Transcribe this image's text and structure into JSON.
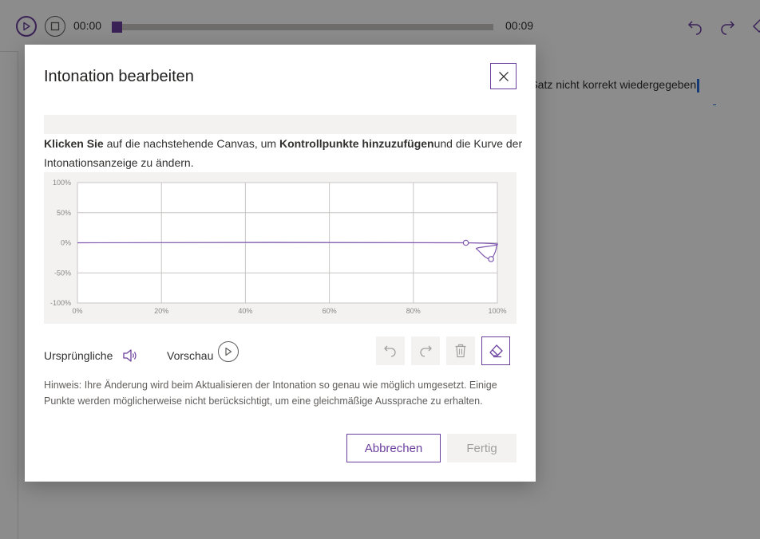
{
  "player": {
    "time_current": "00:00",
    "time_total": "00:09",
    "progress_fraction": 0.0,
    "icons": [
      "play-icon",
      "stop-icon",
      "undo-icon",
      "redo-icon",
      "eraser-icon"
    ]
  },
  "editor": {
    "visible_text": "er Satz nicht korrekt wiedergegeben"
  },
  "dialog": {
    "title": "Intonation bearbeiten",
    "close_icon": "close-icon",
    "instruction": {
      "bold1": "Klicken Sie",
      "text1": " auf die nachstehende Canvas, um ",
      "bold2": "Kontrollpunkte hinzuzufügen",
      "text2": "und die Kurve der Intonationsanzeige zu ändern."
    },
    "controls": {
      "original_label": "Ursprüngliche",
      "preview_label": "Vorschau",
      "speaker_icon": "speaker-icon",
      "play_icon": "play-icon"
    },
    "toolbar_icons": [
      "undo-icon",
      "redo-icon",
      "trash-icon",
      "eraser-icon"
    ],
    "hint": "Hinweis: Ihre Änderung wird beim Aktualisieren der Intonation so genau wie möglich umgesetzt. Einige Punkte werden möglicherweise nicht berücksichtigt, um eine gleichmäßige Aussprache zu erhalten.",
    "cancel_label": "Abbrechen",
    "done_label": "Fertig"
  },
  "chart_data": {
    "type": "line",
    "y_tick_labels": [
      "100%",
      "50%",
      "0%",
      "-50%",
      "-100%"
    ],
    "x_tick_labels": [
      "0%",
      "20%",
      "40%",
      "60%",
      "80%",
      "100%"
    ],
    "xlim": [
      0,
      100
    ],
    "ylim": [
      -100,
      100
    ],
    "grid": true,
    "series_color": "#7f57b0",
    "control_points": [
      {
        "x": 92.5,
        "y": 0
      },
      {
        "x": 98.5,
        "y": -27
      }
    ],
    "curve": [
      {
        "x": 0,
        "y": 0
      },
      {
        "x": 92.5,
        "y": 0
      },
      {
        "x": 95,
        "y": -10
      },
      {
        "x": 97,
        "y": -23
      },
      {
        "x": 98.5,
        "y": -27
      },
      {
        "x": 99.5,
        "y": -15
      },
      {
        "x": 100,
        "y": 0
      }
    ]
  },
  "colors": {
    "accent": "#6b3f9e",
    "overlay": "rgba(0,0,0,0.45)",
    "disabled_bg": "#f3f2f1"
  }
}
